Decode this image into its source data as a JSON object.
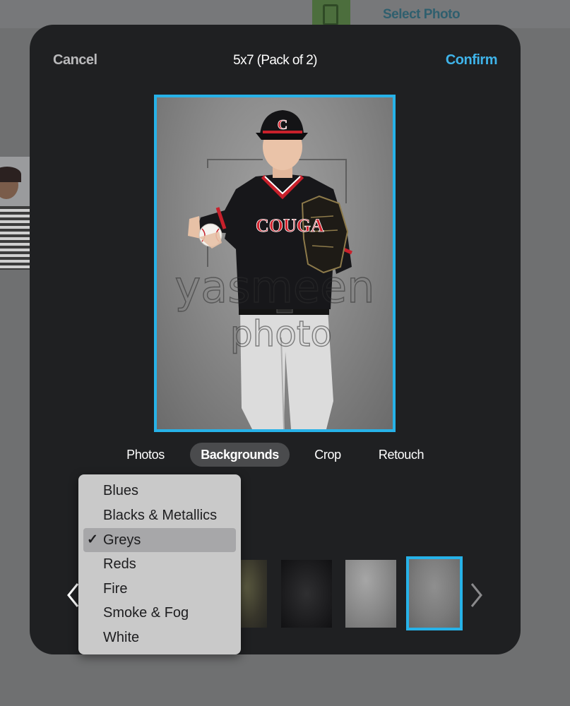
{
  "background_page": {
    "select_photo_label": "Select Photo"
  },
  "modal": {
    "cancel_label": "Cancel",
    "title": "5x7 (Pack of 2)",
    "confirm_label": "Confirm",
    "accent_color": "#27b2e8"
  },
  "preview": {
    "jersey_text": "COUGA",
    "cap_letter": "C",
    "watermark_line1": "yasmeen",
    "watermark_line2": "photo"
  },
  "tabs": [
    {
      "label": "Photos",
      "active": false
    },
    {
      "label": "Backgrounds",
      "active": true
    },
    {
      "label": "Crop",
      "active": false
    },
    {
      "label": "Retouch",
      "active": false
    }
  ],
  "background_menu": {
    "selected": "Greys",
    "items": [
      "Blues",
      "Blacks & Metallics",
      "Greys",
      "Reds",
      "Fire",
      "Smoke & Fog",
      "White"
    ],
    "check_glyph": "✓"
  },
  "swatches": [
    {
      "name": "smoke-olive"
    },
    {
      "name": "black-texture"
    },
    {
      "name": "light-grey"
    },
    {
      "name": "mid-grey",
      "selected": true
    }
  ]
}
